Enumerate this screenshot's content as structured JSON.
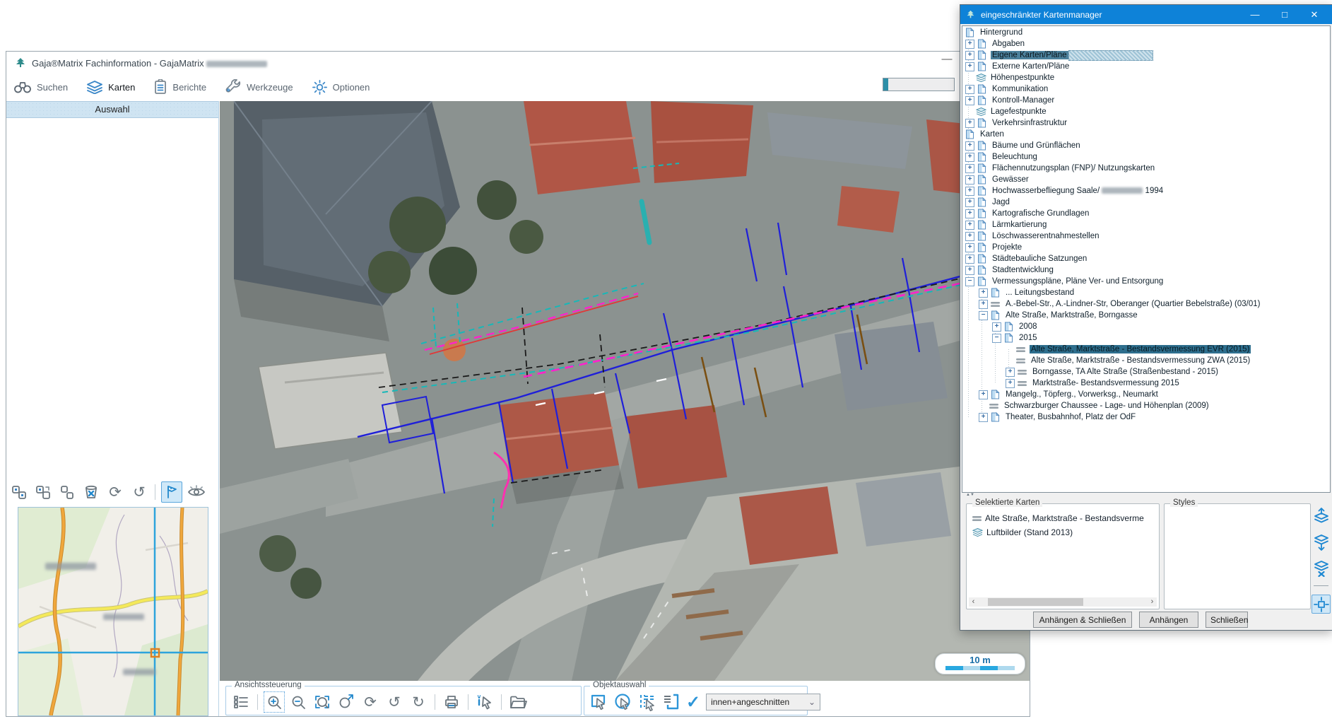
{
  "colors": {
    "dialog_title_blue": "#0e82d8",
    "selection_teal": "#2e6f8e",
    "accent_blue": "#3a87c8",
    "groupbox_blue": "#a8cce8",
    "scale_blue": "#29a8e0",
    "scale_pale": "#aed9ee"
  },
  "main_window": {
    "title": "Gaja®Matrix Fachinformation - GajaMatrix",
    "minimize_glyph": "—",
    "toolbar": {
      "items": [
        {
          "label": "Suchen",
          "icon": "binoculars",
          "active": false
        },
        {
          "label": "Karten",
          "icon": "layers-blue",
          "active": true
        },
        {
          "label": "Berichte",
          "icon": "report",
          "active": false
        },
        {
          "label": "Werkzeuge",
          "icon": "wrench",
          "active": false
        },
        {
          "label": "Optionen",
          "icon": "gear",
          "active": false
        }
      ]
    },
    "sidebar": {
      "header": "Auswahl",
      "tools": [
        {
          "name": "select-new",
          "icon": "sel-new",
          "active": false
        },
        {
          "name": "select-add",
          "icon": "sel-corner",
          "active": false
        },
        {
          "name": "select-boxes",
          "icon": "sel-boxes",
          "active": false
        },
        {
          "name": "clear-selection",
          "icon": "trash-x",
          "active": false
        },
        {
          "name": "refresh-selection",
          "icon": "refresh",
          "active": false
        },
        {
          "name": "undo-selection",
          "icon": "undo",
          "active": false
        },
        {
          "name": "separator",
          "icon": "sep",
          "active": false
        },
        {
          "name": "flag",
          "icon": "flag",
          "active": true
        },
        {
          "name": "show-eye",
          "icon": "eye",
          "active": false
        }
      ]
    },
    "map": {
      "scale_label": "10 m"
    },
    "view_toolbar": {
      "label": "Ansichtssteuerung",
      "icons": [
        {
          "name": "layer-list",
          "icon": "list",
          "active": false
        },
        {
          "name": "separator",
          "icon": "sep",
          "active": false
        },
        {
          "name": "zoom-in",
          "icon": "zoom-in",
          "active": true
        },
        {
          "name": "zoom-out",
          "icon": "zoom-out",
          "active": false
        },
        {
          "name": "zoom-window",
          "icon": "zoom-window",
          "active": false
        },
        {
          "name": "zoom-extent",
          "icon": "zoom-extent",
          "active": false
        },
        {
          "name": "refresh-view",
          "icon": "refresh",
          "active": false
        },
        {
          "name": "undo-view",
          "icon": "undo",
          "active": false
        },
        {
          "name": "redo-view",
          "icon": "redo",
          "active": false
        },
        {
          "name": "separator",
          "icon": "sep",
          "active": false
        },
        {
          "name": "print",
          "icon": "print",
          "active": false
        },
        {
          "name": "separator",
          "icon": "sep",
          "active": false
        },
        {
          "name": "info-select",
          "icon": "info-cursor",
          "active": false
        },
        {
          "name": "separator",
          "icon": "sep",
          "active": false
        },
        {
          "name": "open-folder",
          "icon": "folder",
          "active": false
        }
      ]
    },
    "object_toolbar": {
      "label": "Objektauswahl",
      "icons": [
        {
          "name": "select-polygon",
          "icon": "cursor-poly",
          "active": false
        },
        {
          "name": "select-circle",
          "icon": "cursor-circle",
          "active": false
        },
        {
          "name": "select-line",
          "icon": "cursor-dash",
          "active": false
        },
        {
          "name": "select-list",
          "icon": "select-list",
          "active": false
        },
        {
          "name": "apply-selection",
          "icon": "check",
          "active": false
        }
      ],
      "dropdown_value": "innen+angeschnitten",
      "dropdown_chevron": "⌄"
    }
  },
  "dialog": {
    "title": "eingeschränkter Kartenmanager",
    "window_buttons": {
      "minimize": "—",
      "maximize": "□",
      "close": "✕"
    },
    "splitter_glyphs": "▲▼",
    "tree": [
      {
        "label": "Hintergrund",
        "level": 0,
        "expander": "none",
        "icon": "doc",
        "root": true
      },
      {
        "label": "Abgaben",
        "level": 0,
        "expander": "plus",
        "icon": "doc"
      },
      {
        "label": "Eigene Karten/Pläne",
        "level": 0,
        "expander": "plus",
        "icon": "doc",
        "selected": "hatch"
      },
      {
        "label": "Externe Karten/Pläne",
        "level": 0,
        "expander": "plus",
        "icon": "doc"
      },
      {
        "label": "Höhenpestpunkte",
        "level": 0,
        "expander": "none",
        "icon": "layers"
      },
      {
        "label": "Kommunikation",
        "level": 0,
        "expander": "plus",
        "icon": "doc"
      },
      {
        "label": "Kontroll-Manager",
        "level": 0,
        "expander": "plus",
        "icon": "doc"
      },
      {
        "label": "Lagefestpunkte",
        "level": 0,
        "expander": "none",
        "icon": "layers"
      },
      {
        "label": "Verkehrsinfrastruktur",
        "level": 0,
        "expander": "plus",
        "icon": "doc"
      },
      {
        "label": "Karten",
        "level": 0,
        "expander": "none",
        "icon": "doc",
        "root": true
      },
      {
        "label": "Bäume und Grünflächen",
        "level": 0,
        "expander": "plus",
        "icon": "doc"
      },
      {
        "label": "Beleuchtung",
        "level": 0,
        "expander": "plus",
        "icon": "doc"
      },
      {
        "label": "Flächennutzungsplan (FNP)/ Nutzungskarten",
        "level": 0,
        "expander": "plus",
        "icon": "doc"
      },
      {
        "label": "Gewässer",
        "level": 0,
        "expander": "plus",
        "icon": "doc"
      },
      {
        "label": "Hochwasserbefliegung Saale/",
        "level": 0,
        "expander": "plus",
        "icon": "doc",
        "redacted": true,
        "label_suffix": "1994"
      },
      {
        "label": "Jagd",
        "level": 0,
        "expander": "plus",
        "icon": "doc"
      },
      {
        "label": "Kartografische Grundlagen",
        "level": 0,
        "expander": "plus",
        "icon": "doc"
      },
      {
        "label": "Lärmkartierung",
        "level": 0,
        "expander": "plus",
        "icon": "doc"
      },
      {
        "label": "Löschwasserentnahmestellen",
        "level": 0,
        "expander": "plus",
        "icon": "doc"
      },
      {
        "label": "Projekte",
        "level": 0,
        "expander": "plus",
        "icon": "doc"
      },
      {
        "label": "Städtebauliche Satzungen",
        "level": 0,
        "expander": "plus",
        "icon": "doc"
      },
      {
        "label": "Stadtentwicklung",
        "level": 0,
        "expander": "plus",
        "icon": "doc"
      },
      {
        "label": "Vermessungspläne, Pläne Ver- und Entsorgung",
        "level": 0,
        "expander": "minus",
        "icon": "doc"
      },
      {
        "label": "... Leitungsbestand",
        "level": 1,
        "expander": "plus",
        "icon": "doc"
      },
      {
        "label": "A.-Bebel-Str., A.-Lindner-Str, Oberanger (Quartier Bebelstraße) (03/01)",
        "level": 1,
        "expander": "plus",
        "icon": "plan"
      },
      {
        "label": "Alte Straße, Marktstraße, Borngasse",
        "level": 1,
        "expander": "minus",
        "icon": "doc"
      },
      {
        "label": "2008",
        "level": 2,
        "expander": "plus",
        "icon": "doc"
      },
      {
        "label": "2015",
        "level": 2,
        "expander": "minus",
        "icon": "doc"
      },
      {
        "label": "Alte Straße, Marktstraße - Bestandsvermessung EVR (2015)",
        "level": 3,
        "expander": "none",
        "icon": "plan",
        "selected": "solid"
      },
      {
        "label": "Alte Straße, Marktstraße - Bestandsvermessung ZWA (2015)",
        "level": 3,
        "expander": "none",
        "icon": "plan"
      },
      {
        "label": "Borngasse, TA Alte Straße (Straßenbestand - 2015)",
        "level": 3,
        "expander": "plus",
        "icon": "plan"
      },
      {
        "label": "Marktstraße- Bestandsvermessung 2015",
        "level": 3,
        "expander": "plus",
        "icon": "plan"
      },
      {
        "label": "Mangelg., Töpferg., Vorwerksg., Neumarkt",
        "level": 1,
        "expander": "plus",
        "icon": "doc"
      },
      {
        "label": "Schwarzburger Chaussee - Lage- und Höhenplan (2009)",
        "level": 1,
        "expander": "none",
        "icon": "plan"
      },
      {
        "label": "Theater, Busbahnhof, Platz der OdF",
        "level": 1,
        "expander": "plus",
        "icon": "doc"
      }
    ],
    "selected_maps": {
      "label": "Selektierte Karten",
      "items": [
        {
          "icon": "plan",
          "label": "Alte Straße, Marktstraße - Bestandsverme"
        },
        {
          "icon": "layers",
          "label": "Luftbilder (Stand 2013)"
        }
      ],
      "scroll_left": "‹",
      "scroll_right": "›"
    },
    "styles_box": {
      "label": "Styles"
    },
    "layer_tools": [
      {
        "name": "layer-move-up",
        "icon": "layers-up",
        "active": false
      },
      {
        "name": "layer-move-down",
        "icon": "layers-down",
        "active": false
      },
      {
        "name": "layer-remove",
        "icon": "layers-x",
        "active": false
      },
      {
        "name": "separator",
        "icon": "hsep",
        "active": false
      },
      {
        "name": "layer-center",
        "icon": "layers-center",
        "active": true
      }
    ],
    "buttons": [
      "Anhängen & Schließen",
      "Anhängen",
      "Schließen"
    ]
  }
}
